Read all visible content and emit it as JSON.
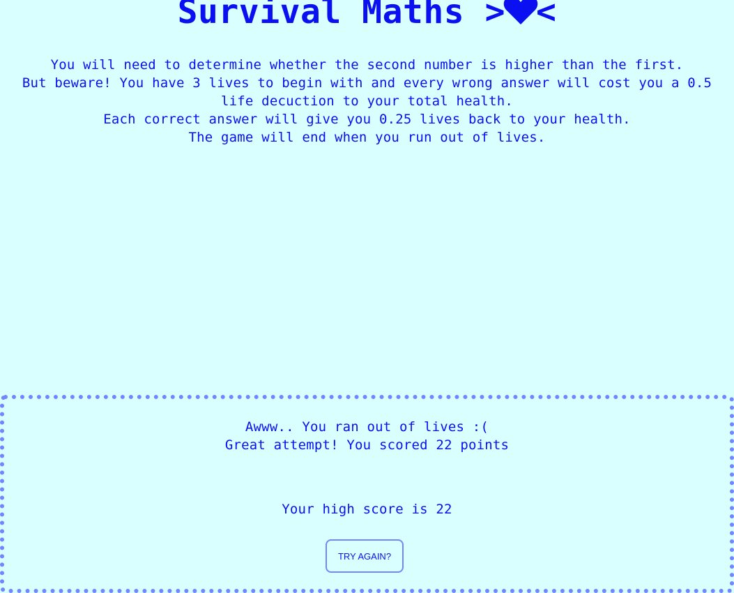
{
  "header": {
    "title": "Survival Maths",
    "title_prefix": ">",
    "title_suffix": "<",
    "icon": "heart-icon"
  },
  "instructions": [
    "You will need to determine whether the second number is higher than the first.",
    "But beware! You have 3 lives to begin with and every wrong answer will cost you a 0.5 life decuction to your total health.",
    "Each correct answer will give you 0.25 lives back to your health.",
    "The game will end when you run out of lives."
  ],
  "result": {
    "game_over_text": "Awww.. You ran out of lives :(",
    "score_text": "Great attempt! You scored 22 points",
    "high_score_text": "Your high score is 22",
    "try_again_label": "TRY AGAIN?"
  },
  "colors": {
    "background": "#d9fffe",
    "text": "#0a10f0",
    "border": "#7186ff"
  }
}
